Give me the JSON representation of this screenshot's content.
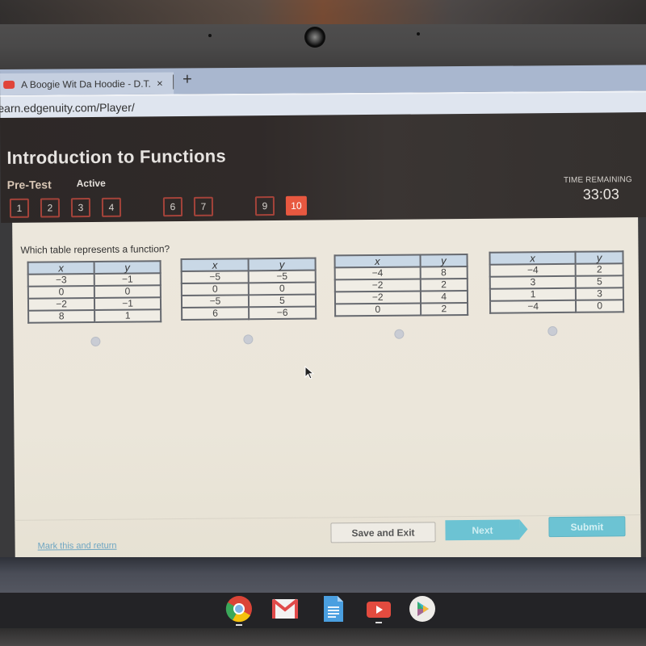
{
  "browser": {
    "tab": {
      "title": "A Boogie Wit Da Hoodie - D.T.B/I",
      "favicon": "youtube-icon",
      "close_icon": "×"
    },
    "new_tab_icon": "+",
    "url": "earn.edgenuity.com/Player/"
  },
  "header": {
    "lesson_title": "Introduction to Functions",
    "assessment_type": "Pre-Test",
    "status": "Active",
    "question_nav": [
      {
        "label": "1",
        "current": false
      },
      {
        "label": "2",
        "current": false
      },
      {
        "label": "3",
        "current": false
      },
      {
        "label": "4",
        "current": false
      },
      {
        "label": "6",
        "current": false
      },
      {
        "label": "7",
        "current": false
      },
      {
        "label": "9",
        "current": false
      },
      {
        "label": "10",
        "current": true
      }
    ],
    "time_remaining_label": "TIME REMAINING",
    "time_remaining_value": "33:03"
  },
  "question": {
    "prompt": "Which table represents a function?",
    "options": [
      {
        "headers": [
          "x",
          "y"
        ],
        "rows": [
          [
            "−3",
            "−1"
          ],
          [
            "0",
            "0"
          ],
          [
            "−2",
            "−1"
          ],
          [
            "8",
            "1"
          ]
        ],
        "selected": false
      },
      {
        "headers": [
          "x",
          "y"
        ],
        "rows": [
          [
            "−5",
            "−5"
          ],
          [
            "0",
            "0"
          ],
          [
            "−5",
            "5"
          ],
          [
            "6",
            "−6"
          ]
        ],
        "selected": false
      },
      {
        "headers": [
          "x",
          "y"
        ],
        "rows": [
          [
            "−4",
            "8"
          ],
          [
            "−2",
            "2"
          ],
          [
            "−2",
            "4"
          ],
          [
            "0",
            "2"
          ]
        ],
        "selected": false
      },
      {
        "headers": [
          "x",
          "y"
        ],
        "rows": [
          [
            "−4",
            "2"
          ],
          [
            "3",
            "5"
          ],
          [
            "1",
            "3"
          ],
          [
            "−4",
            "0"
          ]
        ],
        "selected": false
      }
    ]
  },
  "footer": {
    "mark_link": "Mark this and return",
    "save_exit": "Save and Exit",
    "next": "Next",
    "submit": "Submit"
  },
  "shelf": {
    "apps": [
      {
        "name": "chrome-icon",
        "running": true
      },
      {
        "name": "gmail-icon",
        "running": false
      },
      {
        "name": "docs-icon",
        "running": false
      },
      {
        "name": "youtube-icon",
        "running": true
      },
      {
        "name": "play-store-icon",
        "running": false
      }
    ]
  },
  "colors": {
    "accent_current_question": "#e85840",
    "question_border": "#a4433a",
    "button_primary": "#6cc3d3",
    "link": "#6fa6c2",
    "table_header": "#c9d8e6"
  }
}
